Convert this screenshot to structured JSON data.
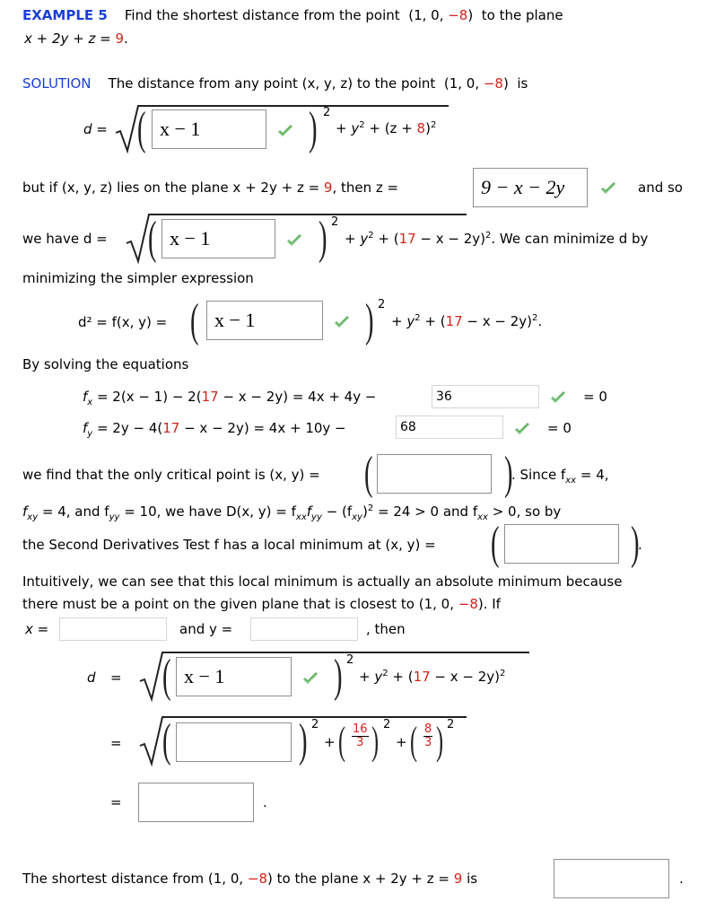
{
  "header": {
    "example_label": "EXAMPLE 5",
    "problem_text_1": "Find the shortest distance from the point",
    "point_prefix": "(1, 0, ",
    "point_neg": "−8",
    "point_suffix": ")",
    "problem_text_2": "to the plane",
    "plane_lhs": "x + 2y + z = ",
    "plane_rhs": "9",
    "period": "."
  },
  "solution": {
    "label": "SOLUTION",
    "intro": "The distance from any point (x, y, z) to the point",
    "point_prefix": "(1, 0, ",
    "point_neg": "−8",
    "point_suffix": ")",
    "is": "is"
  },
  "eq1": {
    "lhs": "d =",
    "answer": "x − 1",
    "rest_a": "+ y",
    "rest_b": " + (z + ",
    "rest_red": "8",
    "rest_c": ")"
  },
  "line_plane": {
    "text_a": "but if  (x, y, z)  lies on the plane  x + 2y + z = ",
    "red": "9",
    "text_b": ",  then  z =",
    "answer": "9 − x − 2y",
    "and_so": "and so"
  },
  "eq2": {
    "prefix": "we have  d =",
    "answer": "x − 1",
    "rest_a": "+ y",
    "rest_b": " + (",
    "rest_red": "17",
    "rest_c": " − x − 2y)",
    "rest_d": ".  We can minimize d by"
  },
  "minimizing_text": "minimizing the simpler expression",
  "eq3": {
    "lhs": "d² = f(x, y) =",
    "answer": "x − 1",
    "rest_a": "+ y",
    "rest_b": " + (",
    "rest_red": "17",
    "rest_c": " − x − 2y)",
    "rest_d": "."
  },
  "solving_text": "By solving the equations",
  "fx": {
    "lhs": "f",
    "sub": "x",
    "expr_a": " =  2(x − 1) − 2(",
    "red": "17",
    "expr_b": " − x − 2y) = 4x + 4y −",
    "answer": "36",
    "eq_zero": "= 0"
  },
  "fy": {
    "lhs": "f",
    "sub": "y",
    "expr_a": " =  2y − 4(",
    "red": "17",
    "expr_b": " − x − 2y) = 4x + 10y −",
    "answer": "68",
    "eq_zero": "= 0"
  },
  "critical": {
    "text_a": "we find that the only critical point is  (x, y) =",
    "answer": "",
    "text_b": ".  Since  f",
    "sub": "xx",
    "text_c": " = 4,"
  },
  "second_line": {
    "t1": "f",
    "s1": "xy",
    "t2": " = 4,  and  f",
    "s2": "yy",
    "t3": " = 10,  we have  D(x, y) = f",
    "s3": "xx",
    "t4": "f",
    "s4": "yy",
    "t5": " − (f",
    "s5": "xy",
    "t6": ")",
    "t7": " = 24 > 0  and  f",
    "s7": "xx",
    "t8": " > 0,  so by"
  },
  "local_min": {
    "text": "the Second Derivatives Test f has a local minimum at  (x, y) =",
    "answer": "",
    "period": "."
  },
  "intuitive": {
    "line1": "Intuitively, we can see that this local minimum is actually an absolute minimum because",
    "line2_a": "there must be a point on the given plane that is closest to  (1, 0, ",
    "line2_red": "−8",
    "line2_b": ").  If",
    "x_label": "x =",
    "x_answer": "",
    "and_y_label": "and  y =",
    "y_answer": "",
    "then": ",  then"
  },
  "eq4": {
    "lhs": "d",
    "equals": "=",
    "answer": "x − 1",
    "rest_a": "+ y",
    "rest_b": " + (",
    "rest_red": "17",
    "rest_c": " − x − 2y)"
  },
  "eq5": {
    "equals": "=",
    "answer": "",
    "plus": "+",
    "frac1_num": "16",
    "frac1_den": "3",
    "frac2_num": "8",
    "frac2_den": "3"
  },
  "eq6": {
    "equals": "=",
    "answer": "",
    "period": "."
  },
  "final": {
    "text_a": "The shortest distance from  (1, 0, ",
    "red1": "−8",
    "text_b": ")  to the plane  x + 2y + z = ",
    "red2": "9",
    "text_c": "  is",
    "answer": "",
    "period": "."
  },
  "exponent_two": "2",
  "colors": {
    "heading_blue": "#1a3fd6",
    "highlight_red": "#d2241c",
    "check_green": "#5cad5c"
  }
}
